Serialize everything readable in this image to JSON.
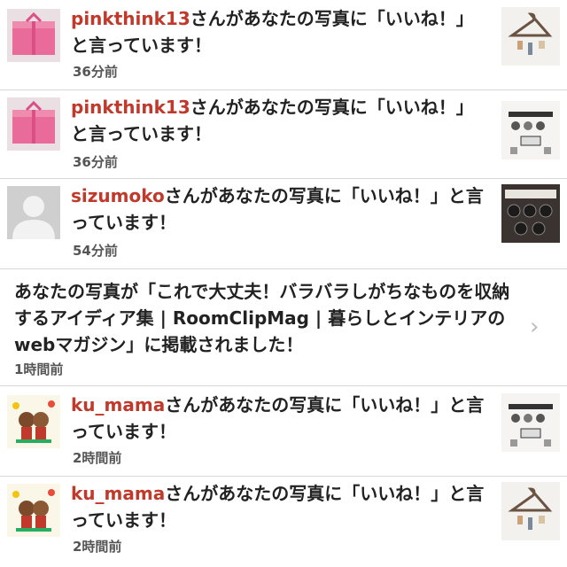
{
  "notifications": [
    {
      "user": "pinkthink13",
      "message": "さんがあなたの写真に「いいね！」と言っています！",
      "time": "36分前",
      "avatar_icon": "pink-gift-box-icon",
      "thumb_icon": "hanger-photo-icon"
    },
    {
      "user": "pinkthink13",
      "message": "さんがあなたの写真に「いいね！」と言っています！",
      "time": "36分前",
      "avatar_icon": "pink-gift-box-icon",
      "thumb_icon": "shelf-photo-icon"
    },
    {
      "user": "sizumoko",
      "message": "さんがあなたの写真に「いいね！」と言っています！",
      "time": "54分前",
      "avatar_icon": "default-person-icon",
      "thumb_icon": "storage-box-photo-icon"
    },
    {
      "user": "ku_mama",
      "message": "さんがあなたの写真に「いいね！」と言っています！",
      "time": "2時間前",
      "avatar_icon": "teddy-bears-icon",
      "thumb_icon": "shelf-photo-icon"
    },
    {
      "user": "ku_mama",
      "message": "さんがあなたの写真に「いいね！」と言っています！",
      "time": "2時間前",
      "avatar_icon": "teddy-bears-icon",
      "thumb_icon": "hanger-photo-icon"
    }
  ],
  "notice": {
    "message": "あなたの写真が「これで大丈夫！バラバラしがちなものを収納するアイディア集 | RoomClipMag | 暮らしとインテリアのwebマガジン」に掲載されました！",
    "time": "1時間前",
    "chevron_icon": "chevron-right-icon"
  },
  "colors": {
    "username": "#c0392b",
    "text": "#222222",
    "time": "#555555",
    "divider": "#d8d8d8"
  }
}
